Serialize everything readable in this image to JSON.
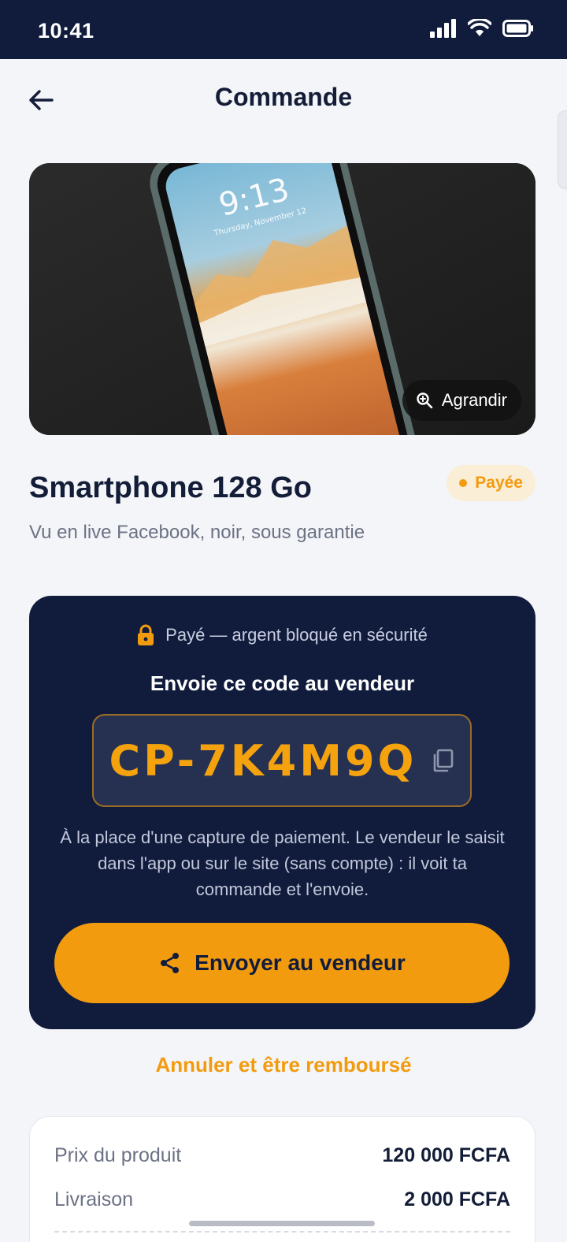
{
  "status_bar": {
    "time": "10:41"
  },
  "header": {
    "title": "Commande"
  },
  "product": {
    "zoom_label": "Agrandir",
    "title": "Smartphone 128 Go",
    "badge": "Payée",
    "subtitle": "Vu en live Facebook, noir, sous garantie",
    "screen_time": "9:13",
    "screen_date": "Thursday, November 12"
  },
  "code_card": {
    "secure_text": "Payé — argent bloqué en sécurité",
    "heading": "Envoie ce code au vendeur",
    "code": "CP-7K4M9Q",
    "help_text": "À la place d'une capture de paiement. Le vendeur le saisit dans l'app ou sur le site (sans compte) : il voit ta commande et l'envoie.",
    "send_button": "Envoyer au vendeur"
  },
  "cancel_link": "Annuler et être remboursé",
  "summary": {
    "rows": [
      {
        "label": "Prix du produit",
        "value": "120 000 FCFA"
      },
      {
        "label": "Livraison",
        "value": "2 000 FCFA"
      }
    ]
  },
  "colors": {
    "navy": "#111c3d",
    "accent": "#f29b0e",
    "background": "#f4f5f8"
  },
  "icons": [
    "signal-icon",
    "wifi-icon",
    "battery-icon",
    "back-arrow-icon",
    "zoom-icon",
    "lock-icon",
    "copy-icon",
    "share-icon"
  ]
}
